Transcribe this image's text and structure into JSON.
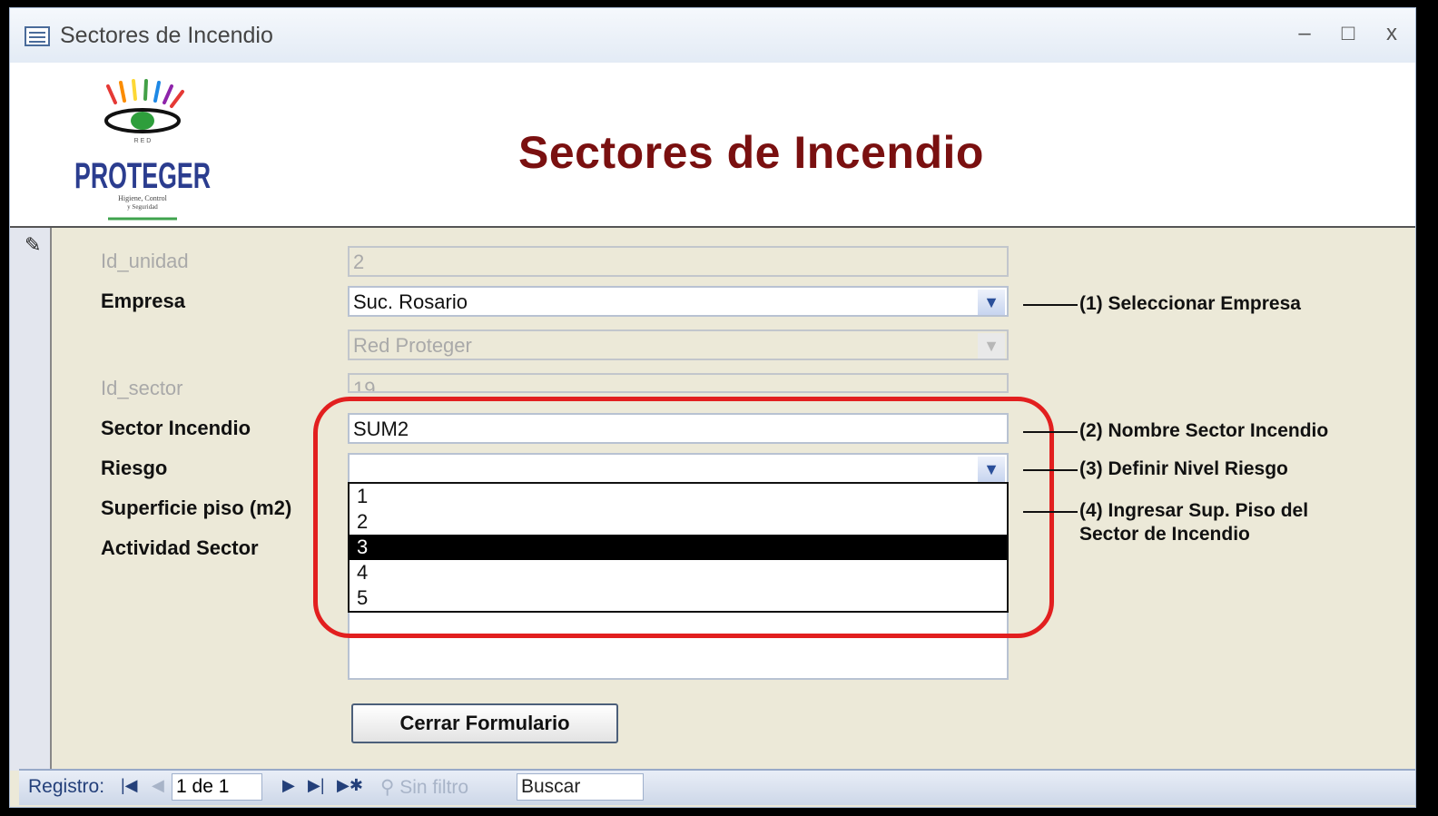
{
  "window": {
    "title": "Sectores de Incendio",
    "minimize": "–",
    "maximize": "□",
    "close": "x"
  },
  "logo": {
    "small_top": "R E D",
    "brand": "PROTEGER",
    "tagline_1": "Higiene, Control",
    "tagline_2": "y Seguridad"
  },
  "header": {
    "title": "Sectores de Incendio"
  },
  "form": {
    "id_unidad": {
      "label": "Id_unidad",
      "value": "2"
    },
    "empresa": {
      "label": "Empresa",
      "value": "Suc. Rosario"
    },
    "empresa_sub": {
      "value": "Red Proteger"
    },
    "id_sector": {
      "label": "Id_sector",
      "value": "19"
    },
    "sector_incendio": {
      "label": "Sector Incendio",
      "value": "SUM2"
    },
    "riesgo": {
      "label": "Riesgo",
      "value": "",
      "options": [
        "1",
        "2",
        "3",
        "4",
        "5"
      ],
      "highlighted": "3"
    },
    "superficie": {
      "label": "Superficie piso (m2)"
    },
    "actividad": {
      "label": "Actividad Sector"
    },
    "close_button": "Cerrar Formulario"
  },
  "notes": {
    "n1": "(1) Seleccionar Empresa",
    "n2": "(2) Nombre Sector Incendio",
    "n3": "(3) Definir Nivel Riesgo",
    "n4_line1": "(4) Ingresar Sup. Piso del",
    "n4_line2": "Sector de Incendio"
  },
  "navbar": {
    "registro_label": "Registro:",
    "record": "1 de 1",
    "filter": "Sin filtro",
    "search": "Buscar"
  },
  "colors": {
    "title_red": "#7a1010",
    "highlight_ring": "#e21f1f",
    "form_bg": "#ece9d8"
  }
}
